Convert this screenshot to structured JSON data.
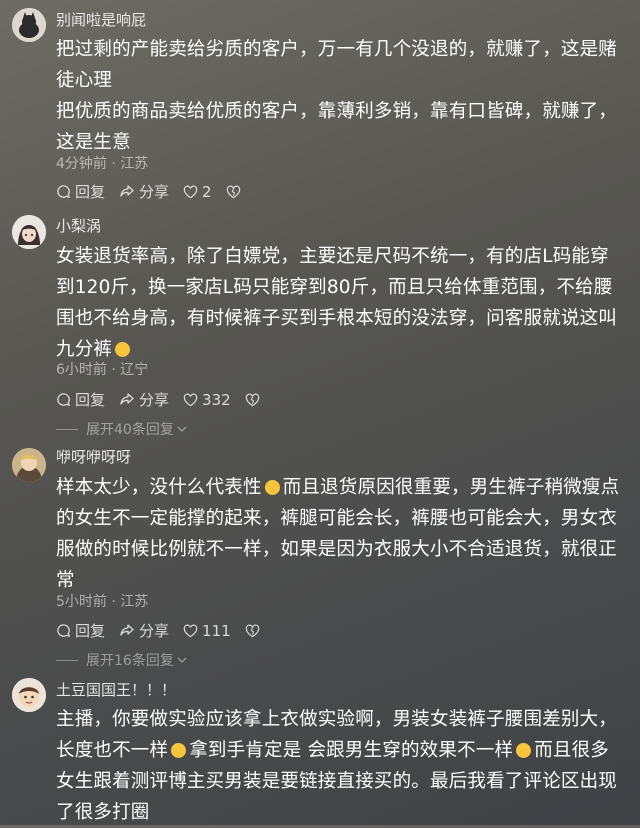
{
  "comments": [
    {
      "username": "别闻啦是响屁",
      "lines": [
        "把过剩的产能卖给劣质的客户，万一有几个没退的，就赚了，这是赌徒心理",
        "把优质的商品卖给优质的客户，靠薄利多销，靠有口皆碑，就赚了，这是生意"
      ],
      "time": "4分钟前",
      "location": "江苏",
      "reply_label": "回复",
      "share_label": "分享",
      "likes": "2"
    },
    {
      "username": "小梨涡",
      "text": "女装退货率高，除了白嫖党，主要还是尺码不统一，有的店L码能穿到120斤，换一家店L码只能穿到80斤，而且只给体重范围，不给腰围也不给身高，有时候裤子买到手根本短的没法穿，问客服就说这叫九分裤",
      "time": "6小时前",
      "location": "辽宁",
      "reply_label": "回复",
      "share_label": "分享",
      "likes": "332",
      "expand_label": "展开40条回复"
    },
    {
      "username": "咿呀咿呀呀",
      "text_a": "样本太少，没什么代表性",
      "text_b": "而且退货原因很重要，男生裤子稍微瘦点的女生不一定能撑的起来，裤腿可能会长，裤腰也可能会大，男女衣服做的时候比例就不一样，如果是因为衣服大小不合适退货，就很正常",
      "time": "5小时前",
      "location": "江苏",
      "reply_label": "回复",
      "share_label": "分享",
      "likes": "111",
      "expand_label": "展开16条回复"
    },
    {
      "username": "土豆国国王！！！",
      "text_a": "主播，你要做实验应该拿上衣做实验啊，男装女装裤子腰围差别大，长度也不一样",
      "text_b": "拿到手肯定是 会跟男生穿的效果不一样",
      "text_c": "而且很多女生跟着测评博主买男装是要链接直接买的。最后我看了评论区出现了很多打圈"
    }
  ],
  "meta_separator": "·",
  "colors": {
    "accent_emoji": "#f6c53b"
  }
}
